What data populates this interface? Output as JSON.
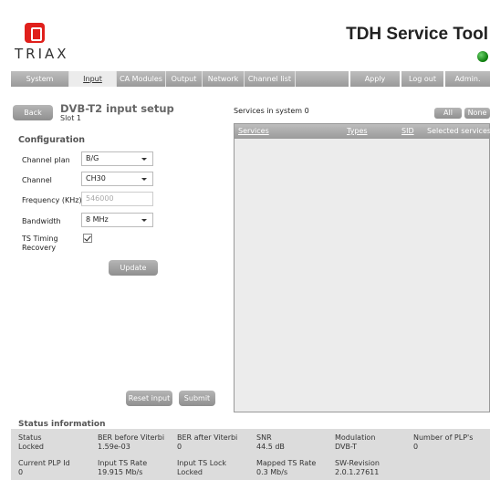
{
  "header": {
    "logo_text": "TRIAX",
    "app_title": "TDH Service Tool"
  },
  "nav": {
    "tabs": [
      {
        "label": "System"
      },
      {
        "label": "Input"
      },
      {
        "label": "CA Modules"
      },
      {
        "label": "Output"
      },
      {
        "label": "Network"
      },
      {
        "label": "Channel list"
      }
    ],
    "active_tab": "Input",
    "buttons": {
      "apply": "Apply",
      "logout": "Log out",
      "admin": "Admin."
    }
  },
  "page": {
    "back_label": "Back",
    "title": "DVB-T2 input setup",
    "subtitle": "Slot 1"
  },
  "config": {
    "heading": "Configuration",
    "channel_plan_label": "Channel plan",
    "channel_plan_value": "B/G",
    "channel_label": "Channel",
    "channel_value": "CH30",
    "frequency_label": "Frequency (KHz)",
    "frequency_placeholder": "546000",
    "bandwidth_label": "Bandwidth",
    "bandwidth_value": "8 MHz",
    "ts_timing_label_1": "TS Timing",
    "ts_timing_label_2": "Recovery",
    "ts_timing_checked": true,
    "update_label": "Update",
    "reset_label": "Reset input",
    "submit_label": "Submit"
  },
  "services": {
    "heading": "Services in system 0",
    "all_label": "All",
    "none_label": "None",
    "columns": {
      "services": "Services",
      "types": "Types",
      "sid": "SID",
      "selected": "Selected services"
    }
  },
  "status": {
    "heading": "Status information",
    "row1": [
      {
        "label": "Status",
        "value": "Locked"
      },
      {
        "label": "BER before Viterbi",
        "value": "1.59e-03"
      },
      {
        "label": "BER after Viterbi",
        "value": "0"
      },
      {
        "label": "SNR",
        "value": "44.5 dB"
      },
      {
        "label": "Modulation",
        "value": "DVB-T"
      },
      {
        "label": "Number of PLP's",
        "value": "0"
      }
    ],
    "row2": [
      {
        "label": "Current PLP Id",
        "value": "0"
      },
      {
        "label": "Input TS Rate",
        "value": "19.915 Mb/s"
      },
      {
        "label": "Input TS Lock",
        "value": "Locked"
      },
      {
        "label": "Mapped TS Rate",
        "value": "0.3 Mb/s"
      },
      {
        "label": "SW-Revision",
        "value": "2.0.1.27611"
      }
    ]
  }
}
